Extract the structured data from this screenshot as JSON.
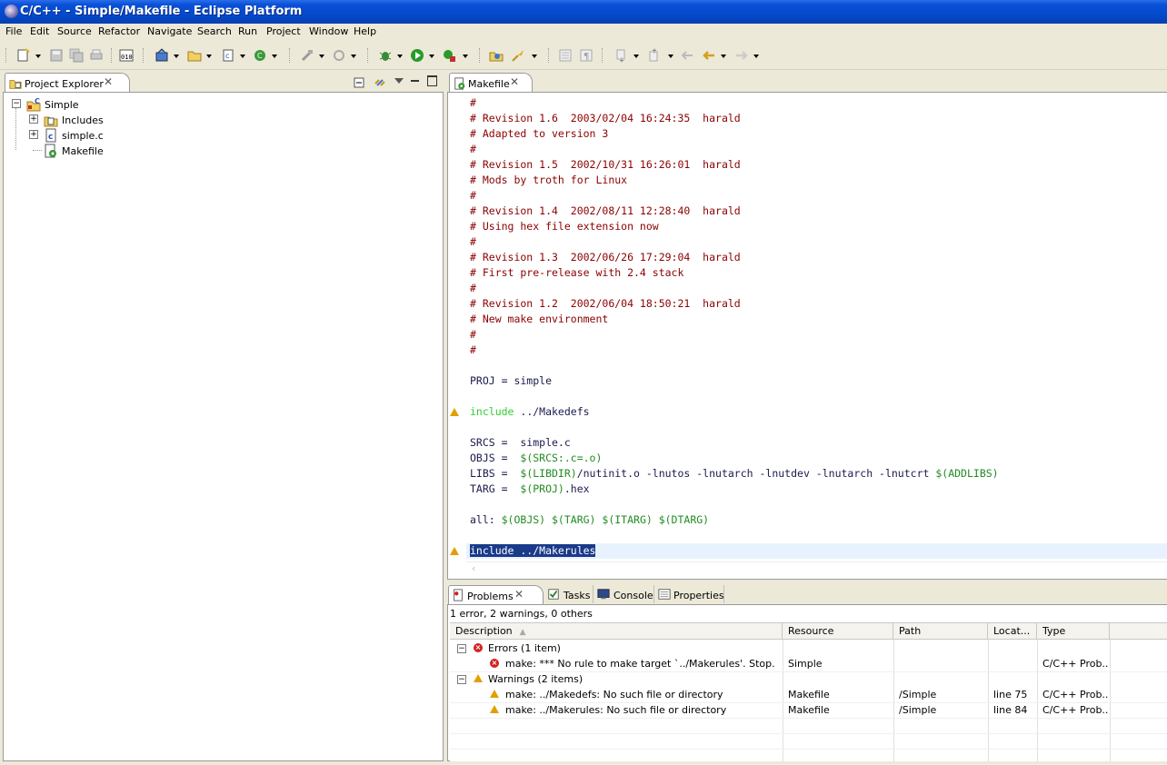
{
  "window": {
    "title": "C/C++ - Simple/Makefile - Eclipse Platform"
  },
  "menu": [
    "File",
    "Edit",
    "Source",
    "Refactor",
    "Navigate",
    "Search",
    "Run",
    "Project",
    "Window",
    "Help"
  ],
  "toolbar_icons": [
    "new-icon",
    "save-icon",
    "save-all-icon",
    "print-icon",
    "binary-icon",
    "new-project-icon",
    "new-folder-icon",
    "new-file-icon",
    "new-class-icon",
    "build-icon",
    "refresh-icon",
    "debug-icon",
    "run-icon",
    "external-tools-icon",
    "open-type-icon",
    "search-icon",
    "toggle-mark-icon",
    "toggle-whitespace-icon",
    "next-annotation-icon",
    "prev-annotation-icon",
    "last-edit-icon",
    "back-icon",
    "forward-icon"
  ],
  "explorer": {
    "tab_label": "Project Explorer",
    "project": "Simple",
    "items": [
      {
        "label": "Includes",
        "icon": "includes-icon"
      },
      {
        "label": "simple.c",
        "icon": "c-file-icon"
      },
      {
        "label": "Makefile",
        "icon": "makefile-icon"
      }
    ]
  },
  "editor": {
    "tab_label": "Makefile",
    "lines": [
      [
        [
          "#",
          "comment"
        ]
      ],
      [
        [
          "# Revision 1.6  2003/02/04 16:24:35  harald",
          "comment"
        ]
      ],
      [
        [
          "# Adapted to version 3",
          "comment"
        ]
      ],
      [
        [
          "#",
          "comment"
        ]
      ],
      [
        [
          "# Revision 1.5  2002/10/31 16:26:01  harald",
          "comment"
        ]
      ],
      [
        [
          "# Mods by troth for Linux",
          "comment"
        ]
      ],
      [
        [
          "#",
          "comment"
        ]
      ],
      [
        [
          "# Revision 1.4  2002/08/11 12:28:40  harald",
          "comment"
        ]
      ],
      [
        [
          "# Using hex file extension now",
          "comment"
        ]
      ],
      [
        [
          "#",
          "comment"
        ]
      ],
      [
        [
          "# Revision 1.3  2002/06/26 17:29:04  harald",
          "comment"
        ]
      ],
      [
        [
          "# First pre-release with 2.4 stack",
          "comment"
        ]
      ],
      [
        [
          "#",
          "comment"
        ]
      ],
      [
        [
          "# Revision 1.2  2002/06/04 18:50:21  harald",
          "comment"
        ]
      ],
      [
        [
          "# New make environment",
          "comment"
        ]
      ],
      [
        [
          "#",
          "comment"
        ]
      ],
      [
        [
          "#",
          "comment"
        ]
      ],
      [],
      [
        [
          "PROJ = simple",
          "plain"
        ]
      ],
      [],
      [
        [
          "include",
          "kw"
        ],
        [
          " ../Makedefs",
          "plain"
        ]
      ],
      [],
      [
        [
          "SRCS =  simple.c",
          "plain"
        ]
      ],
      [
        [
          "OBJS =  ",
          "plain"
        ],
        [
          "$(SRCS:.c=.o)",
          "var"
        ]
      ],
      [
        [
          "LIBS =  ",
          "plain"
        ],
        [
          "$(LIBDIR)",
          "var"
        ],
        [
          "/nutinit.o -lnutos -lnutarch -lnutdev -lnutarch -lnutcrt ",
          "plain"
        ],
        [
          "$(ADDLIBS)",
          "var"
        ]
      ],
      [
        [
          "TARG =  ",
          "plain"
        ],
        [
          "$(PROJ)",
          "var"
        ],
        [
          ".hex",
          "plain"
        ]
      ],
      [],
      [
        [
          "all: ",
          "plain"
        ],
        [
          "$(OBJS) $(TARG) $(ITARG) $(DTARG)",
          "var"
        ]
      ],
      [],
      [
        [
          "include ../Makerules",
          "sel"
        ]
      ]
    ],
    "warning_lines": [
      20,
      29
    ]
  },
  "bottom": {
    "tabs": [
      "Problems",
      "Tasks",
      "Console",
      "Properties"
    ],
    "summary": "1 error, 2 warnings, 0 others",
    "columns": [
      "Description",
      "Resource",
      "Path",
      "Locat...",
      "Type"
    ],
    "groups": [
      {
        "label": "Errors (1 item)",
        "kind": "error",
        "rows": [
          {
            "description": "make: *** No rule to make target `../Makerules'.  Stop.",
            "resource": "Simple",
            "path": "",
            "location": "",
            "type": "C/C++ Prob..."
          }
        ]
      },
      {
        "label": "Warnings (2 items)",
        "kind": "warning",
        "rows": [
          {
            "description": "make: ../Makedefs: No such file or directory",
            "resource": "Makefile",
            "path": "/Simple",
            "location": "line 75",
            "type": "C/C++ Prob..."
          },
          {
            "description": "make: ../Makerules: No such file or directory",
            "resource": "Makefile",
            "path": "/Simple",
            "location": "line 84",
            "type": "C/C++ Prob..."
          }
        ]
      }
    ]
  },
  "colors": {
    "title_bar": "#0348c8",
    "comment": "#8b0000",
    "keyword": "#33cc33",
    "variable": "#228b22",
    "selection": "#1a3a8a",
    "current_line": "#e8f2fe"
  }
}
